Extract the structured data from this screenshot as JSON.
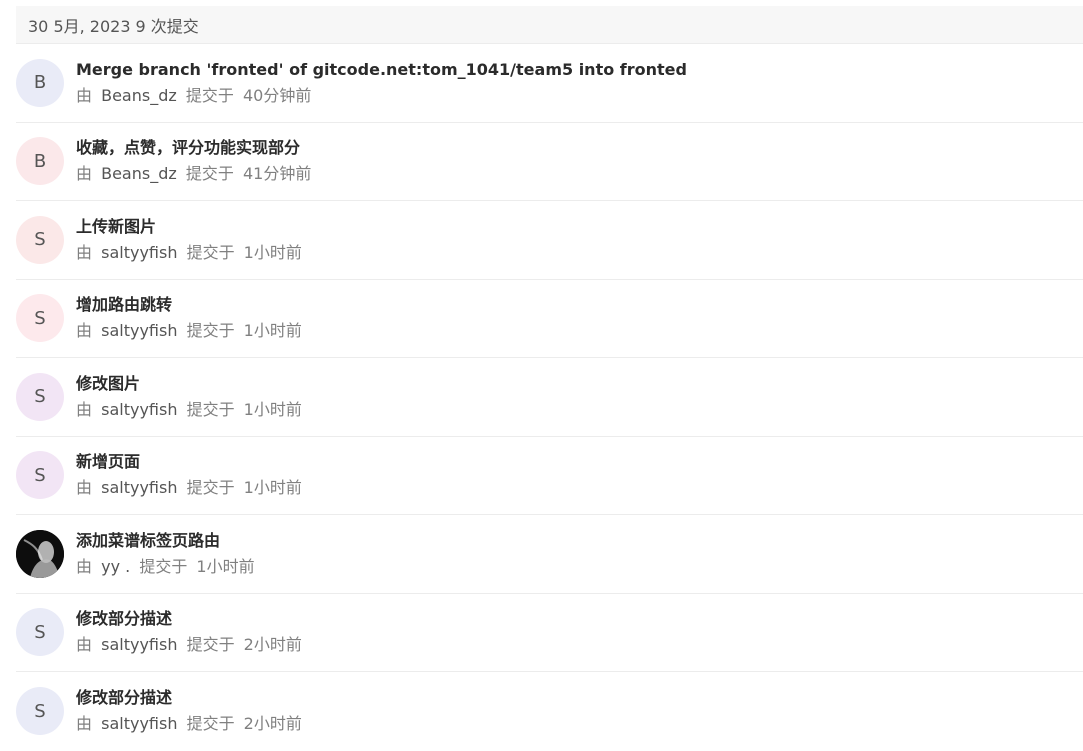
{
  "group": {
    "date": "30 5月, 2023",
    "count_text": "9 次提交"
  },
  "labels": {
    "by": "由",
    "committed": "提交于"
  },
  "commits": [
    {
      "title": "Merge branch 'fronted' of gitcode.net:tom_1041/team5 into fronted",
      "author": "Beans_dz",
      "time": "40分钟前",
      "avatar_letter": "B",
      "avatar_color": "#e9ebf7",
      "avatar_type": "letter"
    },
    {
      "title": "收藏，点赞，评分功能实现部分",
      "author": "Beans_dz",
      "time": "41分钟前",
      "avatar_letter": "B",
      "avatar_color": "#fbe8ea",
      "avatar_type": "letter"
    },
    {
      "title": "上传新图片",
      "author": "saltyyfish",
      "time": "1小时前",
      "avatar_letter": "S",
      "avatar_color": "#fbe8e8",
      "avatar_type": "letter"
    },
    {
      "title": "增加路由跳转",
      "author": "saltyyfish",
      "time": "1小时前",
      "avatar_letter": "S",
      "avatar_color": "#fde9ec",
      "avatar_type": "letter"
    },
    {
      "title": "修改图片",
      "author": "saltyyfish",
      "time": "1小时前",
      "avatar_letter": "S",
      "avatar_color": "#f2e5f5",
      "avatar_type": "letter"
    },
    {
      "title": "新增页面",
      "author": "saltyyfish",
      "time": "1小时前",
      "avatar_letter": "S",
      "avatar_color": "#f2e5f5",
      "avatar_type": "letter"
    },
    {
      "title": "添加菜谱标签页路由",
      "author": "yy .",
      "time": "1小时前",
      "avatar_letter": "",
      "avatar_color": "#111111",
      "avatar_type": "photo"
    },
    {
      "title": "修改部分描述",
      "author": "saltyyfish",
      "time": "2小时前",
      "avatar_letter": "S",
      "avatar_color": "#e9ebf7",
      "avatar_type": "letter"
    },
    {
      "title": "修改部分描述",
      "author": "saltyyfish",
      "time": "2小时前",
      "avatar_letter": "S",
      "avatar_color": "#e9ebf7",
      "avatar_type": "letter"
    }
  ]
}
